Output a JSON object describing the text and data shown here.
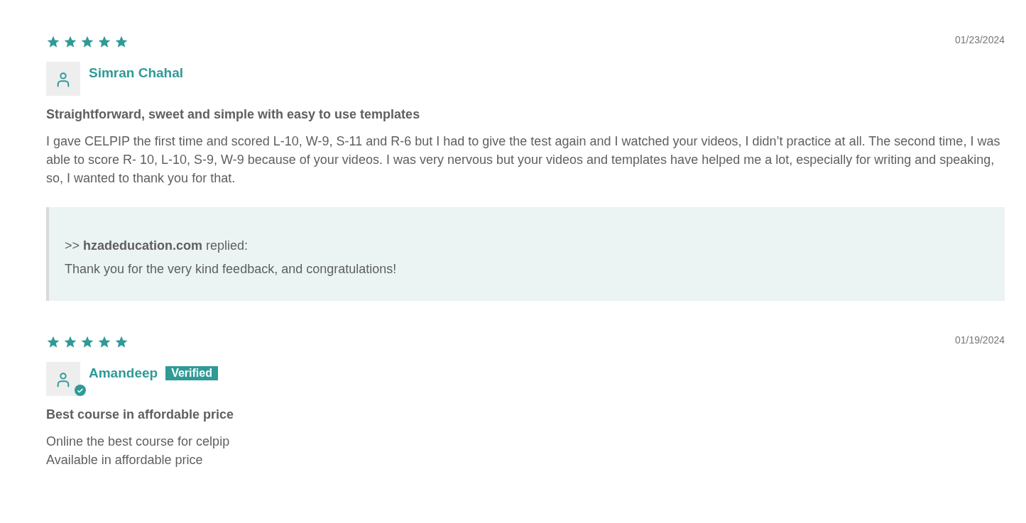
{
  "reviews": [
    {
      "stars": 5,
      "date": "01/23/2024",
      "author": "Simran Chahal",
      "verified": false,
      "title": "Straightforward, sweet and simple with easy to use templates",
      "body": [
        "I gave CELPIP the first time and scored L-10, W-9, S-11 and R-6 but I had to give the test again and I watched your videos, I didn’t practice at all. The second time, I was able to score R- 10, L-10, S-9, W-9 because of your videos. I was very nervous but your videos and templates have helped me a lot, especially for writing and speaking, so, I wanted to thank you for that."
      ],
      "reply": {
        "heading": ">> **hzadeducation.com** replied:",
        "text": "Thank you for the very kind feedback, and congratulations!"
      }
    },
    {
      "stars": 5,
      "date": "01/19/2024",
      "author": "Amandeep",
      "verified": true,
      "badge": "Verified",
      "title": "Best course in affordable price",
      "body": [
        "Online the best course for celpip",
        "Available in affordable price"
      ]
    }
  ]
}
